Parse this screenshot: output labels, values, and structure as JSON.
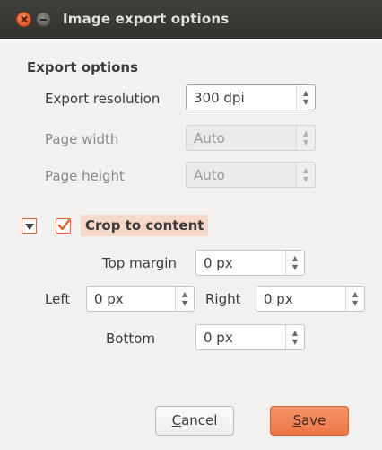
{
  "window": {
    "title": "Image export options"
  },
  "export_options": {
    "group_title": "Export options",
    "resolution": {
      "label": "Export resolution",
      "value": "300 dpi"
    },
    "page_width": {
      "label": "Page width",
      "value": "Auto"
    },
    "page_height": {
      "label": "Page height",
      "value": "Auto"
    }
  },
  "crop": {
    "label": "Crop to content",
    "checked": true,
    "top": {
      "label": "Top margin",
      "value": "0 px"
    },
    "left": {
      "label": "Left",
      "value": "0 px"
    },
    "right": {
      "label": "Right",
      "value": "0 px"
    },
    "bottom": {
      "label": "Bottom",
      "value": "0 px"
    }
  },
  "buttons": {
    "cancel_first": "C",
    "cancel_rest": "ancel",
    "save_first": "S",
    "save_rest": "ave"
  },
  "colors": {
    "accent": "#e2622f",
    "save_button": "#ef7d4f",
    "highlight": "#f6d9c9",
    "titlebar": "#3b3a36"
  }
}
